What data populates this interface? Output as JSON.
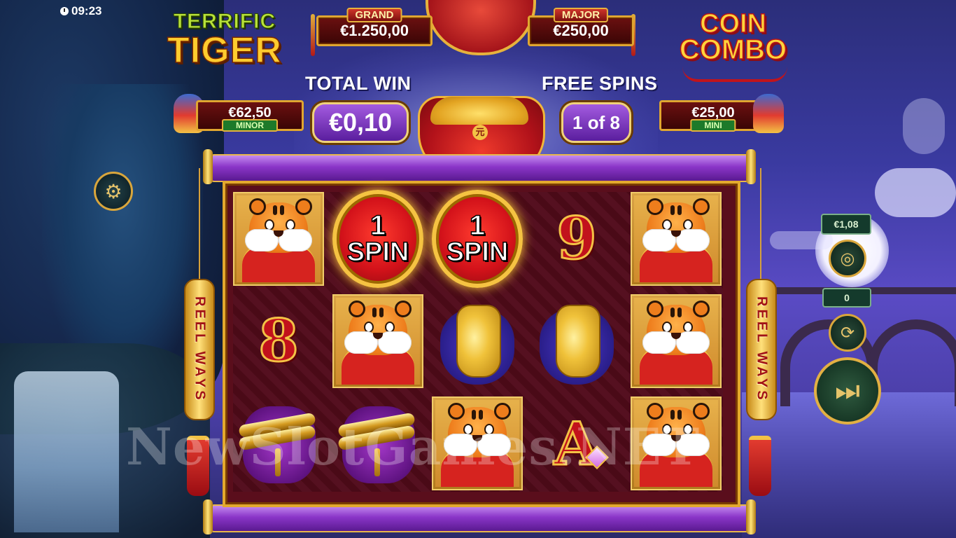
{
  "status_bar": {
    "time": "09:23"
  },
  "logo_left": {
    "line1": "TERRIFIC",
    "line2": "TIGER"
  },
  "logo_right": {
    "line1": "COIN",
    "line2": "COMBO"
  },
  "jackpots": {
    "grand": {
      "label": "GRAND",
      "value": "€1.250,00"
    },
    "major": {
      "label": "MAJOR",
      "value": "€250,00"
    },
    "minor": {
      "label": "MINOR",
      "value": "€62,50"
    },
    "mini": {
      "label": "MINI",
      "value": "€25,00"
    }
  },
  "total_win": {
    "label": "TOTAL WIN",
    "value": "€0,10"
  },
  "free_spins": {
    "label": "FREE SPINS",
    "value": "1 of 8"
  },
  "side_banner_text": "REEL WAYS",
  "reels": {
    "columns": [
      [
        "tiger",
        "8",
        "scroll"
      ],
      [
        "spin-coin",
        "tiger",
        "scroll"
      ],
      [
        "spin-coin",
        "vase",
        "tiger"
      ],
      [
        "9",
        "vase",
        "A"
      ],
      [
        "tiger",
        "tiger",
        "tiger"
      ]
    ],
    "spin_coin": {
      "number": "1",
      "text": "SPIN"
    },
    "symbols": {
      "eight": "8",
      "nine": "9",
      "ace": "A"
    }
  },
  "controls": {
    "bet_value": "€1,08",
    "autoplay_count": "0",
    "settings_icon": "gear-icon",
    "coins_icon": "coin-stack-icon",
    "autoplay_icon": "autoplay-icon",
    "play_icon": "skip-play-icon"
  },
  "watermark": "NewSlotGames.NET",
  "colors": {
    "accent_gold": "#e3a92e",
    "reel_bg": "#4a0a17",
    "pill_purple": "#8a35c8"
  }
}
